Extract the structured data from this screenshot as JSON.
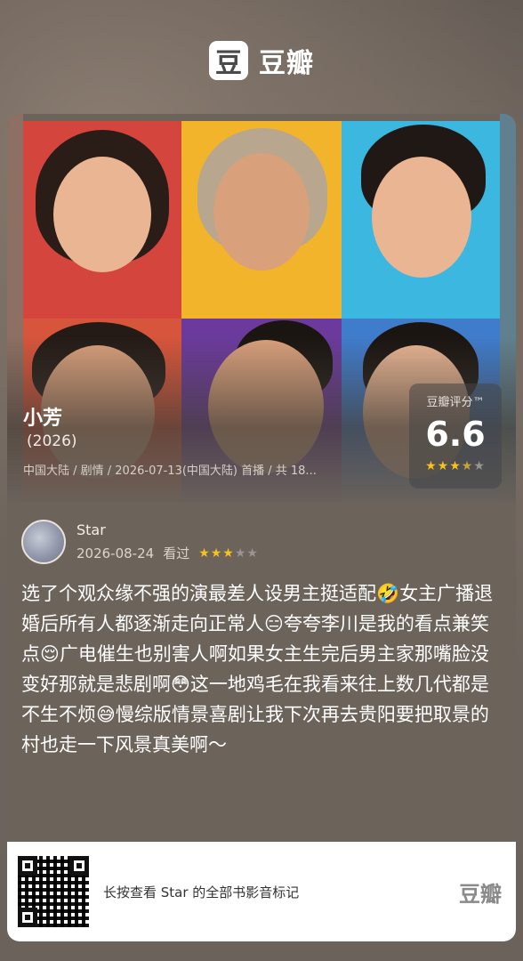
{
  "header": {
    "logo_glyph": "豆",
    "brand_name": "豆瓣"
  },
  "movie": {
    "title": "小芳",
    "year": "(2026)",
    "meta": "中国大陆 / 剧情 / 2026-07-13(中国大陆) 首播 / 共 18...",
    "rating_label": "豆瓣评分™",
    "rating_score": "6.6",
    "rating_stars_on": "★★★",
    "rating_stars_half": "★",
    "rating_stars_off": "★"
  },
  "review": {
    "user_name": "Star",
    "date": "2026-08-24",
    "status": "看过",
    "stars_on": "★★★",
    "stars_off": "★★",
    "text": "选了个观众缘不强的演最差人设男主挺适配🤣女主广播退婚后所有人都逐渐走向正常人😑夸夸李川是我的看点兼笑点😌广电催生也别害人啊如果女主生完后男主家那嘴脸没变好那就是悲剧啊😳这一地鸡毛在我看来往上数几代都是不生不烦😅慢综版情景喜剧让我下次再去贵阳要把取景的村也走一下风景真美啊～"
  },
  "footer": {
    "hint": "长按查看 Star 的全部书影音标记",
    "brand": "豆瓣"
  },
  "colors": {
    "star": "#f7c21a",
    "background": "#6b625a"
  }
}
